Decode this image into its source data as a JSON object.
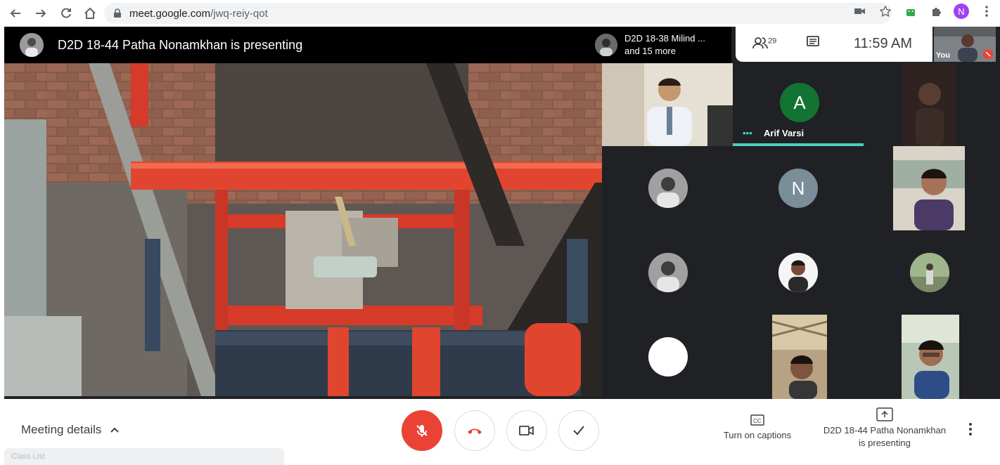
{
  "browser": {
    "url_host": "meet.google.com",
    "url_path": "/jwq-reiy-qot",
    "profile_initial": "N"
  },
  "meeting": {
    "presenter_banner": "D2D 18-44 Patha Nonamkhan is presenting",
    "mini_presenter_line1": "D2D 18-38 Milind ...",
    "mini_presenter_line2": "and 15 more",
    "participant_count": "29",
    "clock": "11:59 AM",
    "self_label": "You"
  },
  "tiles": {
    "arif": {
      "initial": "A",
      "name": "Arif Varsi",
      "color": "#137333"
    },
    "n_tile": {
      "initial": "N",
      "color": "#7a8e99"
    }
  },
  "bottom": {
    "meeting_details": "Meeting details",
    "captions_label": "Turn on captions",
    "present_line1": "D2D 18-44 Patha Nonamkhan",
    "present_line2": "is presenting",
    "ghost_text": "Class List"
  },
  "colors": {
    "hangup_red": "#ea4335",
    "accent_teal": "#4ecdc4"
  }
}
